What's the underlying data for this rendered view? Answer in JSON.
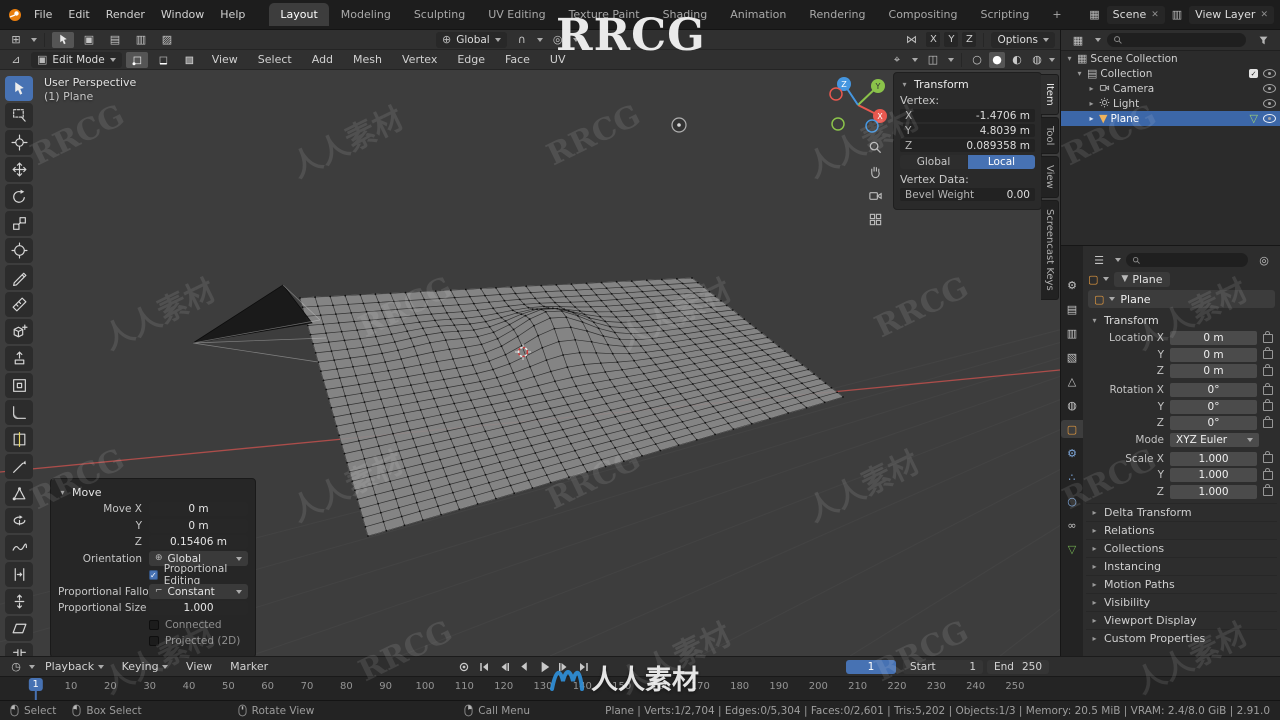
{
  "watermark": {
    "brand": "RRCG",
    "cn": "人人素材"
  },
  "topbar": {
    "menus": [
      "File",
      "Edit",
      "Render",
      "Window",
      "Help"
    ],
    "tabs": [
      "Layout",
      "Modeling",
      "Sculpting",
      "UV Editing",
      "Texture Paint",
      "Shading",
      "Animation",
      "Rendering",
      "Compositing",
      "Scripting"
    ],
    "active_tab": "Layout",
    "add_tab": "+",
    "scene": {
      "label": "Scene"
    },
    "view_layer": {
      "label": "View Layer"
    }
  },
  "tool_settings": {
    "orientation": "Global",
    "mirror_label": [
      "X",
      "Y",
      "Z"
    ],
    "options": "Options"
  },
  "viewport_header": {
    "mode": "Edit Mode",
    "menus": [
      "View",
      "Select",
      "Add",
      "Mesh",
      "Vertex",
      "Edge",
      "Face",
      "UV"
    ]
  },
  "viewport": {
    "view_label": "User Perspective",
    "object_label": "(1) Plane",
    "toolbar_tools": [
      "tweak",
      "select-box",
      "cursor",
      "move",
      "rotate",
      "scale",
      "transform",
      "annotate",
      "measure",
      "add-cube",
      "extrude",
      "inset",
      "bevel",
      "loop-cut",
      "knife",
      "poly-build",
      "spin",
      "smooth",
      "edge-slide",
      "shrink-fatten",
      "shear",
      "rip"
    ],
    "active_tool": "tweak"
  },
  "sidebar": {
    "title": "Transform",
    "vertex_label": "Vertex:",
    "vertex": {
      "x_label": "X",
      "x": "-1.4706 m",
      "y_label": "Y",
      "y": "4.8039 m",
      "z_label": "Z",
      "z": "0.089358 m"
    },
    "space": {
      "global": "Global",
      "local": "Local",
      "active": "Local"
    },
    "vertex_data_label": "Vertex Data:",
    "bevel_label": "Bevel Weight",
    "bevel_value": "0.00",
    "tabs": [
      "Item",
      "Tool",
      "View",
      "Screencast Keys"
    ],
    "active_tab": "Item"
  },
  "outliner": {
    "rows": [
      {
        "label": "Scene Collection"
      },
      {
        "label": "Collection"
      },
      {
        "label": "Camera"
      },
      {
        "label": "Light"
      },
      {
        "label": "Plane"
      }
    ],
    "selected": "Plane"
  },
  "properties": {
    "nav_tabs": [
      "tool",
      "render",
      "output",
      "view-layer",
      "scene",
      "world",
      "object",
      "modifiers",
      "particles",
      "physics",
      "constraints",
      "object-data"
    ],
    "active_nav_tab": "object",
    "breadcrumb": "Plane",
    "object_name": "Plane",
    "transform": {
      "title": "Transform",
      "rows": [
        {
          "label": "Location X",
          "value": "0 m"
        },
        {
          "label": "Y",
          "value": "0 m"
        },
        {
          "label": "Z",
          "value": "0 m"
        },
        {
          "label": "Rotation X",
          "value": "0°"
        },
        {
          "label": "Y",
          "value": "0°"
        },
        {
          "label": "Z",
          "value": "0°"
        },
        {
          "label": "Mode",
          "value": "XYZ Euler"
        },
        {
          "label": "Scale X",
          "value": "1.000"
        },
        {
          "label": "Y",
          "value": "1.000"
        },
        {
          "label": "Z",
          "value": "1.000"
        }
      ]
    },
    "sections": [
      "Delta Transform",
      "Relations",
      "Collections",
      "Instancing",
      "Motion Paths",
      "Visibility",
      "Viewport Display",
      "Custom Properties"
    ]
  },
  "move_panel": {
    "title": "Move",
    "move_x_label": "Move X",
    "x": "0 m",
    "y_label": "Y",
    "y": "0 m",
    "z_label": "Z",
    "z": "0.15406 m",
    "orientation_label": "Orientation",
    "orientation": "Global",
    "prop_edit_label": "Proportional Editing",
    "falloff_label": "Proportional Falloff",
    "falloff": "Constant",
    "size_label": "Proportional Size",
    "size": "1.000",
    "connected_label": "Connected",
    "projected_label": "Projected (2D)"
  },
  "timeline": {
    "menus": [
      "Playback",
      "Keying",
      "View",
      "Marker"
    ],
    "current_frame": "1",
    "start_label": "Start",
    "start": "1",
    "end_label": "End",
    "end": "250",
    "ticks": [
      10,
      20,
      30,
      40,
      50,
      60,
      70,
      80,
      90,
      100,
      110,
      120,
      130,
      140,
      150,
      160,
      170,
      180,
      190,
      200,
      210,
      220,
      230,
      240,
      250
    ]
  },
  "status_bar": {
    "items": [
      "Select",
      "Box Select",
      "Rotate View",
      "Call Menu"
    ],
    "stats": "Plane | Verts:1/2,704 | Edges:0/5,304 | Faces:0/2,601 | Tris:5,202 | Objects:1/3 | Memory: 20.5 MiB | VRAM: 2.4/8.0 GiB | 2.91.0"
  },
  "colors": {
    "accent": "#4772b3",
    "object_orange": "#e59b40",
    "data_green": "#73b152"
  }
}
